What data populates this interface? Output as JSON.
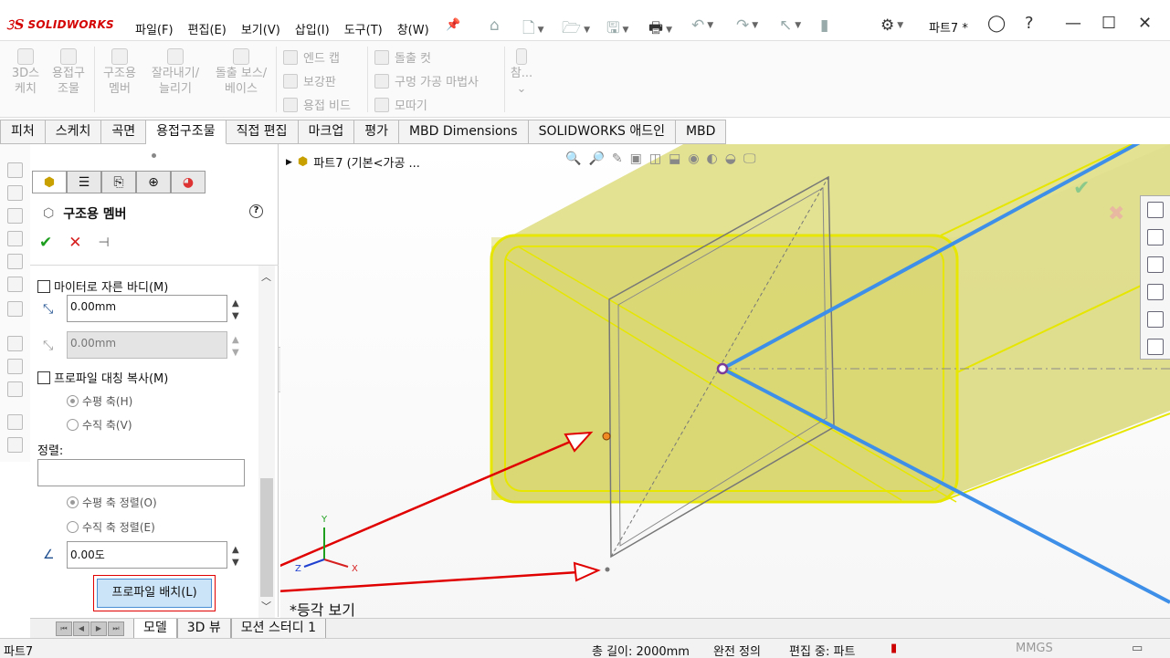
{
  "app": {
    "brand": "SOLIDWORKS",
    "document_title": "파트7 *"
  },
  "menu": [
    "파일(F)",
    "편집(E)",
    "보기(V)",
    "삽입(I)",
    "도구(T)",
    "창(W)"
  ],
  "command_manager": {
    "big_buttons": [
      {
        "line1": "3D스",
        "line2": "케치"
      },
      {
        "line1": "용접구",
        "line2": "조물"
      },
      {
        "line1": "구조용",
        "line2": "멤버"
      },
      {
        "line1": "잘라내기/",
        "line2": "늘리기"
      },
      {
        "line1": "돌출 보스/",
        "line2": "베이스"
      }
    ],
    "col1": [
      "엔드 캡",
      "보강판",
      "용접 비드"
    ],
    "col2": [
      "돌출 컷",
      "구멍 가공 마법사",
      "모따기"
    ],
    "ref_label": "참..."
  },
  "tabs": [
    "피처",
    "스케치",
    "곡면",
    "용접구조물",
    "직접 편집",
    "마크업",
    "평가",
    "MBD Dimensions",
    "SOLIDWORKS 애드인",
    "MBD"
  ],
  "active_tab": "용접구조물",
  "property_manager": {
    "title": "구조용 멤버",
    "help": "?",
    "miter_trim_label": "마이터로 자른 바디(M)",
    "g1_value": "0.00mm",
    "g2_value": "0.00mm",
    "profile_mirror_label": "프로파일 대칭 복사(M)",
    "horizontal_axis_label": "수평 축(H)",
    "vertical_axis_label": "수직 축(V)",
    "align_label": "정렬:",
    "align_horizontal_label": "수평 축 정렬(O)",
    "align_vertical_label": "수직 축 정렬(E)",
    "angle_value": "0.00도",
    "profile_position_button": "프로파일 배치(L)"
  },
  "viewport": {
    "tree_node": "파트7  (기본<가공 ...",
    "view_label": "*등각 보기",
    "triad": {
      "x": "X",
      "y": "Y",
      "z": "Z"
    }
  },
  "bottom_tabs": [
    "모델",
    "3D 뷰",
    "모션 스터디 1"
  ],
  "active_bottom_tab": "모델",
  "status": {
    "doc": "파트7",
    "total_length": "총 길이: 2000mm",
    "definition": "완전 정의",
    "editing": "편집 중: 파트",
    "units": "MMGS"
  },
  "colors": {
    "brand_red": "#d40000",
    "part_fill": "#d6d46a",
    "part_edge": "#e6e600",
    "path_line": "#3e8fe8",
    "annotation_red": "#e00000"
  }
}
